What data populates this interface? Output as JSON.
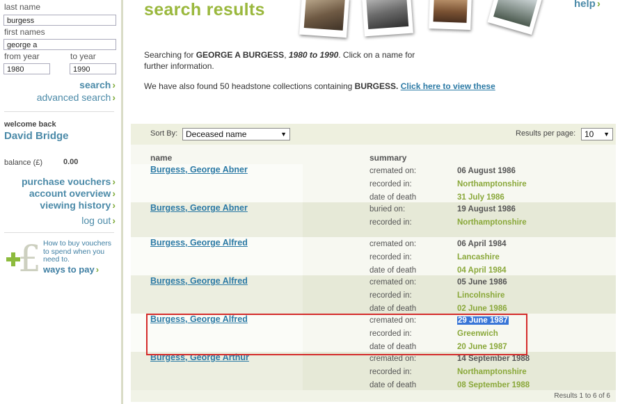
{
  "sidebar": {
    "last_name_label": "last name",
    "last_name_value": "burgess",
    "first_names_label": "first names",
    "first_names_value": "george a",
    "from_year_label": "from year",
    "to_year_label": "to year",
    "from_year_value": "1980",
    "to_year_value": "1990",
    "search_label": "search",
    "advanced_search_label": "advanced search",
    "welcome_label": "welcome back",
    "user_name": "David Bridge",
    "balance_label": "balance (£)",
    "balance_value": "0.00",
    "links": [
      "purchase vouchers",
      "account overview",
      "viewing history",
      "log out"
    ],
    "promo_text": "How to buy vouchers to spend when you need to.",
    "ways_to_pay": "ways to pay"
  },
  "main": {
    "title": "search results",
    "help": "help",
    "search_prefix": "Searching for ",
    "search_name": "GEORGE A BURGESS",
    "search_sep": ", ",
    "search_years": "1980 to 1990",
    "search_suffix": ". Click on a name for",
    "search_suffix2": "further information.",
    "headstone_prefix": "We have also found 50 headstone collections containing ",
    "headstone_name": "BURGESS.",
    "headstone_link": "Click here to view these",
    "sort_label": "Sort By:",
    "sort_value": "Deceased name",
    "rpp_label": "Results per page:",
    "rpp_value": "10",
    "col_name": "name",
    "col_summary": "summary",
    "results_count": "Results 1 to 6 of 6"
  },
  "rows": [
    {
      "name": "Burgess, George Abner",
      "fields": [
        {
          "k": "cremated on:",
          "v": "06 August 1986"
        },
        {
          "k": "recorded in:",
          "v": "Northamptonshire"
        },
        {
          "k": "date of death",
          "v": "31 July 1986"
        }
      ]
    },
    {
      "name": "Burgess, George Abner",
      "fields": [
        {
          "k": "buried on:",
          "v": "19 August 1986"
        },
        {
          "k": "recorded in:",
          "v": "Northamptonshire"
        }
      ]
    },
    {
      "name": "Burgess, George Alfred",
      "fields": [
        {
          "k": "cremated on:",
          "v": "06 April 1984"
        },
        {
          "k": "recorded in:",
          "v": "Lancashire"
        },
        {
          "k": "date of death",
          "v": "04 April 1984"
        }
      ]
    },
    {
      "name": "Burgess, George Alfred",
      "fields": [
        {
          "k": "cremated on:",
          "v": "05 June 1986"
        },
        {
          "k": "recorded in:",
          "v": "Lincolnshire"
        },
        {
          "k": "date of death",
          "v": "02 June 1986"
        }
      ]
    },
    {
      "name": "Burgess, George Alfred",
      "fields": [
        {
          "k": "cremated on:",
          "v": "29 June 1987"
        },
        {
          "k": "recorded in:",
          "v": "Greenwich"
        },
        {
          "k": "date of death",
          "v": "20 June 1987"
        }
      ]
    },
    {
      "name": "Burgess, George Arthur",
      "fields": [
        {
          "k": "cremated on:",
          "v": "14 September 1988"
        },
        {
          "k": "recorded in:",
          "v": "Northamptonshire"
        },
        {
          "k": "date of death",
          "v": "08 September 1988"
        }
      ]
    }
  ],
  "colors": {
    "accent_green": "#9ab83d",
    "link_blue": "#2c7aa5",
    "highlight_red": "#d42a2a"
  }
}
